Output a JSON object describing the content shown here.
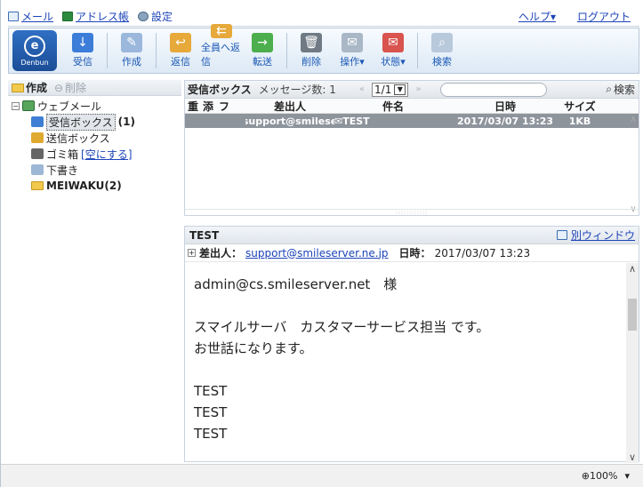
{
  "topnav": {
    "mail": "メール",
    "addressbook": "アドレス帳",
    "settings": "設定",
    "help": "ヘルプ▾",
    "logout": "ログアウト"
  },
  "toolbar": {
    "logo": "Denbun",
    "logo_mark": "e",
    "receive": "受信",
    "compose": "作成",
    "reply": "返信",
    "reply_all": "全員へ返信",
    "forward": "転送",
    "delete": "削除",
    "operation": "操作▾",
    "status": "状態▾",
    "search": "検索"
  },
  "left": {
    "create": "作成",
    "delete": "削除",
    "root": "ウェブメール",
    "inbox": "受信ボックス",
    "inbox_count": "(1)",
    "sent": "送信ボックス",
    "trash": "ゴミ箱",
    "trash_empty": "[空にする]",
    "drafts": "下書き",
    "meiwaku": "MEIWAKU(2)"
  },
  "list": {
    "title": "受信ボックス",
    "count": "メッセージ数: 1",
    "prev": "«",
    "page": "1/1",
    "next": "»",
    "search": "検索",
    "columns": [
      "重",
      "添",
      "フ",
      "差出人",
      "件名",
      "日時",
      "サイズ"
    ],
    "rows": [
      {
        "from": "support@smilese",
        "subject": "TEST",
        "date": "2017/03/07 13:23",
        "size": "1KB"
      }
    ]
  },
  "preview": {
    "subject": "TEST",
    "new_window": "別ウィンドウ",
    "from_label": "差出人：",
    "from": "support@smileserver.ne.jp",
    "date_label": "日時：",
    "date": "2017/03/07 13:23",
    "body": [
      "admin@cs.smileserver.net　様",
      "",
      "スマイルサーバ　カスタマーサービス担当 です。",
      "お世話になります。",
      "",
      "TEST",
      "TEST",
      "TEST"
    ]
  },
  "status": {
    "zoom": "100%",
    "zoom_caret": "▾"
  }
}
